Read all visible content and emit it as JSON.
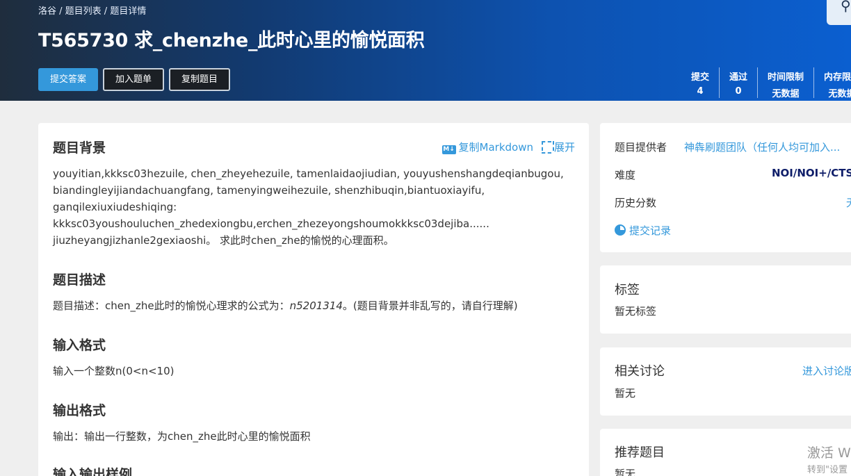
{
  "breadcrumb": [
    "洛谷 / ",
    "题目列表 / ",
    "题目详情"
  ],
  "problem": {
    "title": "T565730 求_chenzhe_此时心里的愉悦面积"
  },
  "actions": {
    "submit": "提交答案",
    "add_to_list": "加入题单",
    "copy": "复制题目"
  },
  "stats": [
    {
      "label": "提交",
      "value": "4"
    },
    {
      "label": "通过",
      "value": "0"
    },
    {
      "label": "时间限制",
      "value": "无数据"
    },
    {
      "label": "内存限制",
      "value": "无数据"
    }
  ],
  "content": {
    "copy_markdown": "复制Markdown",
    "expand": "展开",
    "md_icon_text": "M↓",
    "background_title": "题目背景",
    "background_lines": [
      "youyitian,kkksc03hezuile, chen_zheyehezuile, tamenlaidaojiudian, youyushenshangdeqianbugou,",
      "biandingleyijiandachuangfang, tamenyingweihezuile, shenzhibuqin,biantuoxiayifu,",
      "ganqilexiuxiudeshiqing:",
      "kkksc03youshouluchen_zhedexiongbu,erchen_zhezeyongshoumokkksc03dejiba......",
      "jiuzheyangjizhanle2gexiaoshi。 求此时chen_zhe的愉悦的心理面积。"
    ],
    "description_title": "题目描述",
    "description_prefix": "题目描述：chen_zhe此时的愉悦心理求的公式为：",
    "description_formula": "n5201314",
    "description_suffix": "。(题目背景并非乱写的，请自行理解)",
    "input_title": "输入格式",
    "input_text": "输入一个整数n(0<n<10)",
    "output_title": "输出格式",
    "output_text": "输出：输出一行整数，为chen_zhe此时心里的愉悦面积",
    "samples_title": "输入输出样例"
  },
  "sidebar": {
    "provider_label": "题目提供者",
    "provider_value": "神犇刷题团队（任何人均可加入...",
    "difficulty_label": "难度",
    "difficulty_value": "NOI/NOI+/CTSC",
    "history_label": "历史分数",
    "history_value": "无",
    "submissions_link": "提交记录",
    "tags_title": "标签",
    "tags_value": "暂无标签",
    "discussion_title": "相关讨论",
    "discussion_link": "进入讨论版",
    "discussion_value": "暂无",
    "recommend_title": "推荐题目",
    "recommend_value": "暂无"
  },
  "watermark": {
    "line1": "激活 W",
    "line2": "转到\"设置"
  },
  "colors": {
    "accent": "#3498db",
    "difficulty": "#0e1d69"
  }
}
